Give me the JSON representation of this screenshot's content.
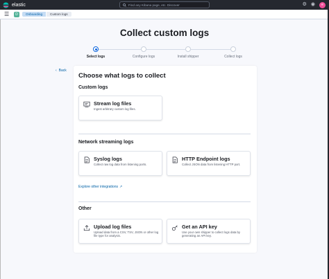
{
  "header": {
    "brand": "elastic",
    "search_placeholder": "Find any Kibana page, etc. Discover",
    "space_initial": "D",
    "avatar_initial": "e"
  },
  "breadcrumbs": [
    "Onboarding",
    "Custom logs"
  ],
  "page_title": "Collect custom logs",
  "steps": [
    {
      "label": "Select logs",
      "active": true
    },
    {
      "label": "Configure logs",
      "active": false
    },
    {
      "label": "Install shipper",
      "active": false
    },
    {
      "label": "Collect logs",
      "active": false
    }
  ],
  "back_label": "Back",
  "panel": {
    "title": "Choose what logs to collect",
    "sections": [
      {
        "title": "Custom logs",
        "cards": [
          {
            "title": "Stream log files",
            "description": "Ingest arbitrary custom log files.",
            "icon": "log-file-icon"
          }
        ]
      },
      {
        "title": "Network streaming logs",
        "cards": [
          {
            "title": "Syslog logs",
            "description": "Collect raw log data from listening ports.",
            "icon": "document-icon"
          },
          {
            "title": "HTTP Endpoint logs",
            "description": "Collect JSON data from listening HTTP port.",
            "icon": "document-icon"
          }
        ],
        "link": "Explore other integrations"
      },
      {
        "title": "Other",
        "cards": [
          {
            "title": "Upload log files",
            "description": "Upload data from a CSV, TSV, JSON or other log file type for analysis.",
            "icon": "upload-icon"
          },
          {
            "title": "Get an API key",
            "description": "Use your own shipper to collect logs data by generating an API key.",
            "icon": "key-icon"
          }
        ]
      }
    ]
  },
  "colors": {
    "topbar": "#25282f",
    "accent": "#0b64dd",
    "link": "#0061a6",
    "background": "#f7f8fc"
  }
}
